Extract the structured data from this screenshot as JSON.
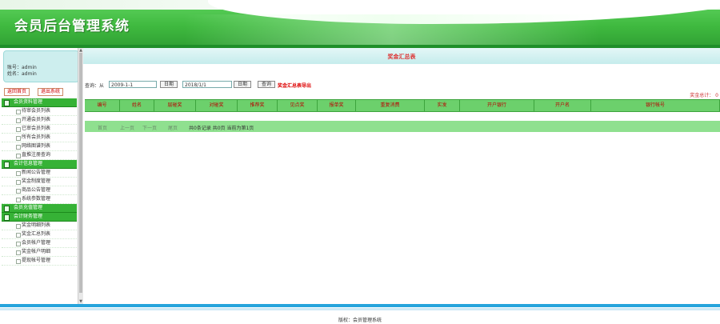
{
  "app": {
    "title": "会员后台管理系统"
  },
  "user": {
    "account_line": "账号：admin",
    "name_line": "姓名：admin"
  },
  "left_buttons": {
    "home": "返回首页",
    "logout": "退出系统"
  },
  "menu": [
    {
      "group": "会员资料管理",
      "items": [
        "待审会员列表",
        "开通会员列表",
        "已审会员列表",
        "所有会员列表",
        "网络图谱列表",
        "直推注册查询"
      ]
    },
    {
      "group": "会计信息管理",
      "items": [
        "新闻公告管理",
        "奖金制度管理",
        "商品公告管理",
        "系统参数管理"
      ]
    },
    {
      "group": "会员充值管理",
      "items": []
    },
    {
      "group": "会计财务管理",
      "items": [
        "奖金明细列表",
        "奖金汇总列表",
        "会员帐户管理",
        "奖金帐户明细",
        "提现帐号管理"
      ]
    }
  ],
  "main": {
    "page_title": "奖金汇总表",
    "filter": {
      "label": "查询：从",
      "from_value": "2009-1-1",
      "date_btn_1": "日期",
      "to_value": "2018/1/1",
      "date_btn_2": "日期",
      "query_btn": "查询",
      "export_link": "奖金汇总表导出"
    },
    "total_label": "奖金总计： 0",
    "columns": [
      "编号",
      "姓名",
      "层碰奖",
      "对碰奖",
      "推荐奖",
      "见点奖",
      "报单奖",
      "重复消费",
      "实发",
      "开户银行",
      "开户名",
      "银行帐号"
    ],
    "pager": {
      "first": "首页",
      "prev": "上一页",
      "next": "下一页",
      "last": "尾页",
      "info": "共0条记录 共0页 当前为第1页"
    }
  },
  "footer": {
    "copyright": "版权：会员管理系统"
  },
  "colors": {
    "brand_green": "#3fb93f",
    "header_row": "#6cd06c",
    "title_red": "#d33333",
    "footer_blue": "#26a4dc"
  }
}
